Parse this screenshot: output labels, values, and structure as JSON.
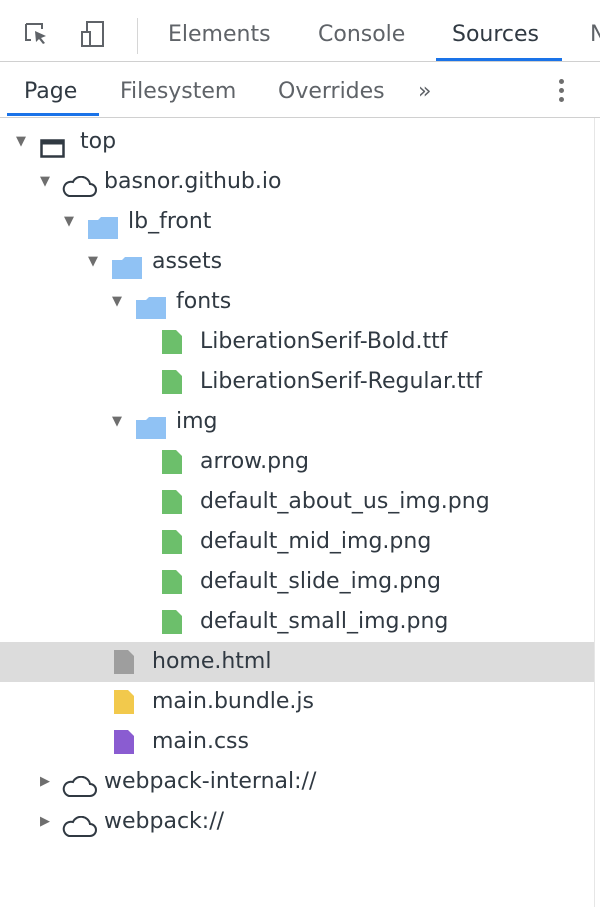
{
  "toolbar": {
    "tabs": [
      {
        "label": "Elements"
      },
      {
        "label": "Console"
      },
      {
        "label": "Sources"
      },
      {
        "label": "N"
      }
    ]
  },
  "sources_panel": {
    "tabs": [
      {
        "label": "Page"
      },
      {
        "label": "Filesystem"
      },
      {
        "label": "Overrides"
      }
    ],
    "more_tabs_label": "»"
  },
  "tree": {
    "top": "top",
    "origin": "basnor.github.io",
    "lb_front": "lb_front",
    "assets": "assets",
    "fonts": "fonts",
    "font_files": [
      "LiberationSerif-Bold.ttf",
      "LiberationSerif-Regular.ttf"
    ],
    "img": "img",
    "img_files": [
      "arrow.png",
      "default_about_us_img.png",
      "default_mid_img.png",
      "default_slide_img.png",
      "default_small_img.png"
    ],
    "home": "home.html",
    "bundle": "main.bundle.js",
    "css": "main.css",
    "webpack_internal": "webpack-internal://",
    "webpack": "webpack://"
  },
  "colors": {
    "accent": "#1a73e8",
    "folder": "#90c2f4",
    "asset_file": "#6cbf6b",
    "html_file": "#9e9e9e",
    "script_file": "#f2c94c",
    "css_file": "#8a5cd1",
    "selected_row": "#dcdcdc"
  },
  "icons": {
    "inspect": "inspect-element-icon",
    "device": "device-toolbar-icon",
    "frame": "frame-icon",
    "cloud": "cloud-icon",
    "folder": "folder-icon",
    "file": "file-icon",
    "more": "more-vertical-icon"
  }
}
